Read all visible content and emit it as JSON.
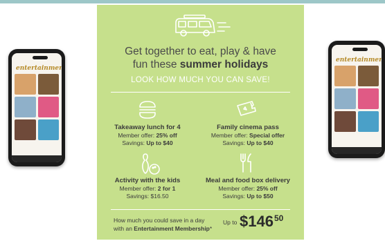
{
  "colors": {
    "panel": "#c6e08c",
    "text": "#3b3b3b",
    "accent": "#ffffff",
    "logo": "#b58a28"
  },
  "phones": {
    "brand": "entertainment",
    "tile_colors": [
      "#d8a26a",
      "#8fb0c9",
      "#c9c3b8",
      "#e05a85",
      "#6f4a3a",
      "#4aa0c8"
    ]
  },
  "icons": [
    "campervan-icon",
    "burger-icon",
    "cinema-ticket-icon",
    "bowling-icon",
    "cutlery-icon"
  ],
  "panel": {
    "headline_line1": "Get together to eat, play & have",
    "headline_line2_prefix": "fun these ",
    "headline_line2_bold": "summer holidays",
    "subheading": "LOOK HOW MUCH YOU CAN SAVE!",
    "items": [
      {
        "title": "Takeaway lunch for 4",
        "offer_label": "Member offer: ",
        "offer": "25% off",
        "savings_label": "Savings: ",
        "savings": "Up to $40"
      },
      {
        "title": "Family cinema pass",
        "offer_label": "Member offer: ",
        "offer": "Special offer",
        "savings_label": "Savings: ",
        "savings": "Up to $40"
      },
      {
        "title": "Activity with the kids",
        "offer_label": "Member offer: ",
        "offer": "2 for 1",
        "savings_label": "Savings: ",
        "savings": "$16.50"
      },
      {
        "title": "Meal and food box delivery",
        "offer_label": "Member offer: ",
        "offer": "25% off",
        "savings_label": "Savings: ",
        "savings": "Up to $50"
      }
    ],
    "footer_line1": "How much you could save in a day",
    "footer_line2_prefix": "with an ",
    "footer_line2_bold": "Entertainment Membership",
    "footer_line2_suffix": "*",
    "upto": "Up to",
    "price_main": "$146",
    "price_cents": "50"
  }
}
